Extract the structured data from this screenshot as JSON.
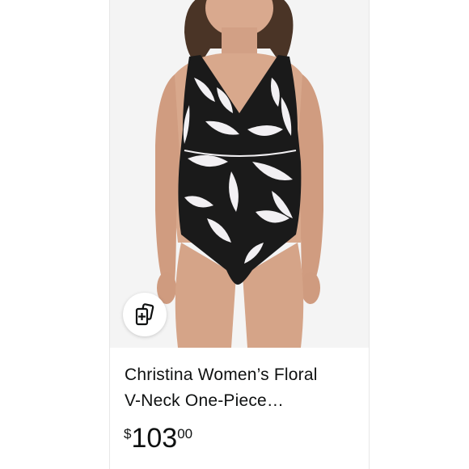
{
  "product": {
    "title_line1": "Christina Women’s Floral",
    "title_line2": "V-Neck One-Piece…",
    "price_symbol": "$",
    "price_whole": "103",
    "price_fraction": "00"
  },
  "icons": {
    "compare": "add-to-compare-cards-icon"
  },
  "colors": {
    "text": "#0f1111",
    "photo_background": "#f4f4f4",
    "swimsuit_dark": "#1a1a1a",
    "swimsuit_light": "#f2f0f3"
  }
}
